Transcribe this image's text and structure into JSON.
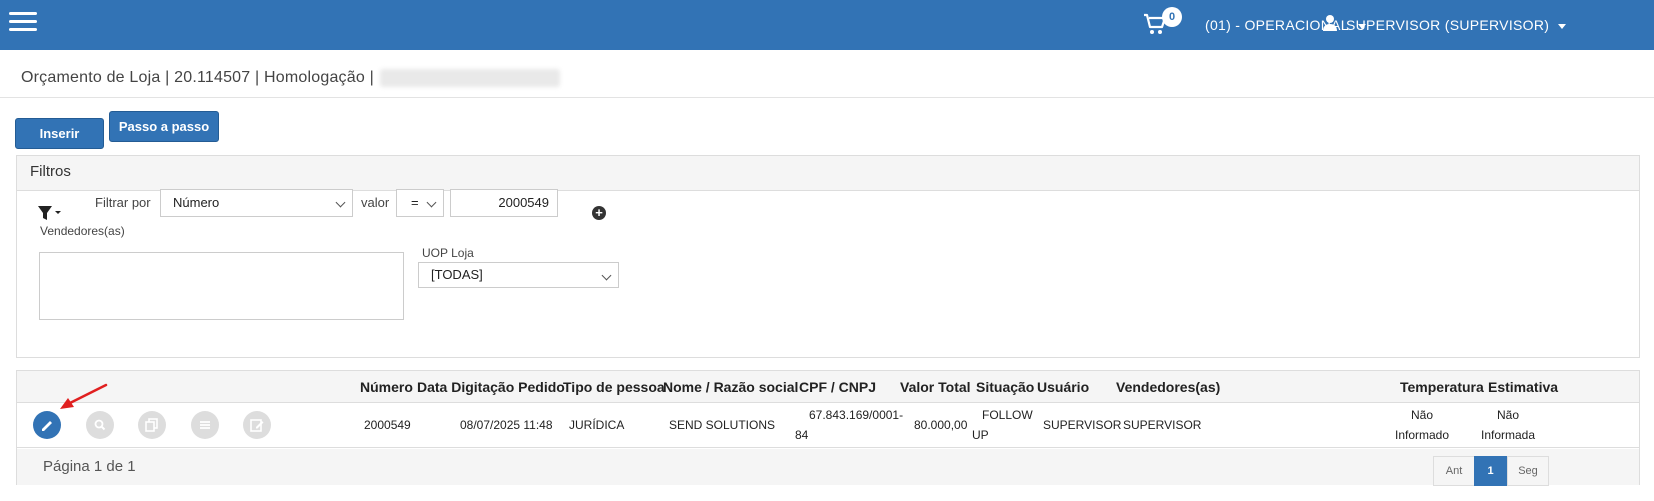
{
  "header": {
    "cart_count": "0",
    "store": "(01) - OPERACIONAL",
    "user": "SUPERVISOR (SUPERVISOR)"
  },
  "page": {
    "title": "Orçamento de Loja | 20.114507 | Homologação |"
  },
  "toolbar": {
    "insert_label": "Inserir",
    "wizard_label": "Passo a passo"
  },
  "filters": {
    "title": "Filtros",
    "filter_by_label": "Filtrar por",
    "filter_by_value": "Número",
    "value_label": "valor",
    "operator_value": "=",
    "value_input": "2000549",
    "sellers_label": "Vendedores(as)",
    "uop_label": "UOP Loja",
    "uop_value": "[TODAS]"
  },
  "grid": {
    "columns": [
      "Número",
      "Data Digitação Pedido",
      "Tipo de pessoa",
      "Nome / Razão social",
      "CPF / CNPJ",
      "Valor Total",
      "Situação",
      "Usuário",
      "Vendedores(as)",
      "Temperatura",
      "Estimativa"
    ],
    "rows": [
      {
        "numero": "2000549",
        "data": "08/07/2025 11:48",
        "tipo": "JURÍDICA",
        "nome": "SEND SOLUTIONS",
        "cnpj_1": "67.843.169/0001-",
        "cnpj_2": "84",
        "valor": "80.000,00",
        "situacao_1": "FOLLOW",
        "situacao_2": "UP",
        "usuario": "SUPERVISOR",
        "vendedores": "SUPERVISOR",
        "temperatura_1": "Não",
        "temperatura_2": "Informado",
        "estimativa_1": "Não",
        "estimativa_2": "Informada"
      }
    ],
    "page_info": "Página 1 de 1",
    "prev_label": "Ant",
    "current_page": "1",
    "next_label": "Seg"
  },
  "colors": {
    "primary": "#3273b5",
    "annotation_arrow": "#e02020"
  }
}
